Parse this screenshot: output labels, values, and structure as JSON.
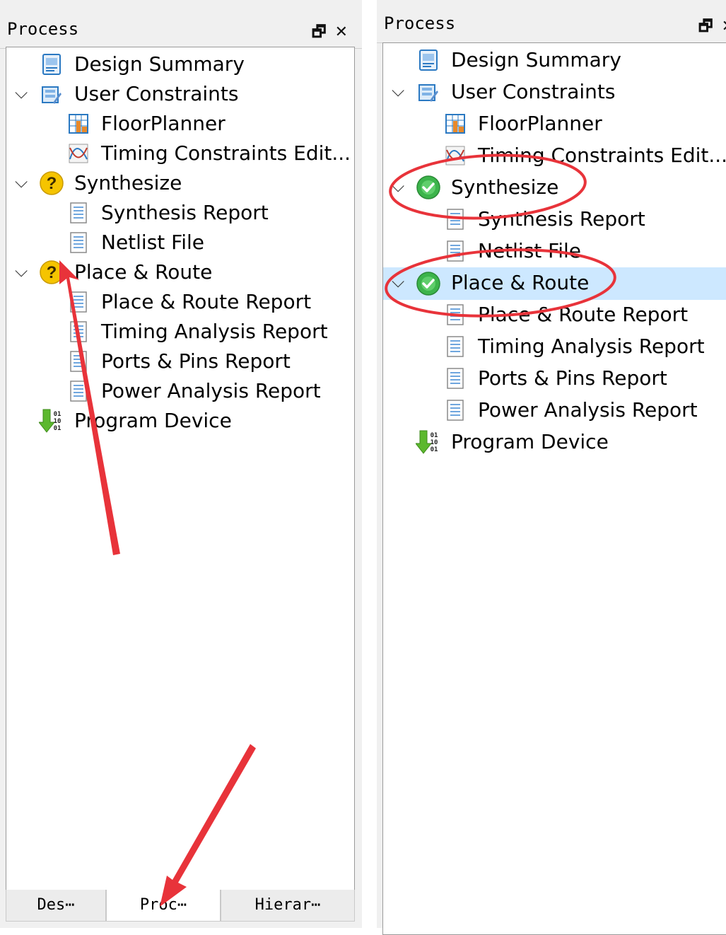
{
  "left_panel": {
    "title": "Process",
    "tree": [
      {
        "label": "Design Summary"
      },
      {
        "label": "User Constraints"
      },
      {
        "label": "FloorPlanner"
      },
      {
        "label": "Timing Constraints Edit..."
      },
      {
        "label": "Synthesize"
      },
      {
        "label": "Synthesis Report"
      },
      {
        "label": "Netlist File"
      },
      {
        "label": "Place & Route"
      },
      {
        "label": "Place & Route Report"
      },
      {
        "label": "Timing Analysis Report"
      },
      {
        "label": "Ports & Pins Report"
      },
      {
        "label": "Power Analysis Report"
      },
      {
        "label": "Program Device"
      }
    ],
    "tabs": [
      {
        "label": "Des⋯"
      },
      {
        "label": "Proc⋯"
      },
      {
        "label": "Hierar⋯"
      }
    ],
    "active_tab": "Proc⋯"
  },
  "right_panel": {
    "title": "Process",
    "tree": [
      {
        "label": "Design Summary"
      },
      {
        "label": "User Constraints"
      },
      {
        "label": "FloorPlanner"
      },
      {
        "label": "Timing Constraints Edit..."
      },
      {
        "label": "Synthesize"
      },
      {
        "label": "Synthesis Report"
      },
      {
        "label": "Netlist File"
      },
      {
        "label": "Place & Route"
      },
      {
        "label": "Place & Route Report"
      },
      {
        "label": "Timing Analysis Report"
      },
      {
        "label": "Ports & Pins Report"
      },
      {
        "label": "Power Analysis Report"
      },
      {
        "label": "Program Device"
      }
    ],
    "selected_item": "Place & Route"
  },
  "icons": {
    "restore": "restore-icon",
    "close": "close-icon",
    "expand": "chevron-down-icon",
    "pending_status": "question-status-icon",
    "success_status": "check-status-icon"
  },
  "colors": {
    "selection": "#cde8ff",
    "annotation": "#e8333a",
    "pending": "#f5c400",
    "success": "#3cb44b"
  }
}
